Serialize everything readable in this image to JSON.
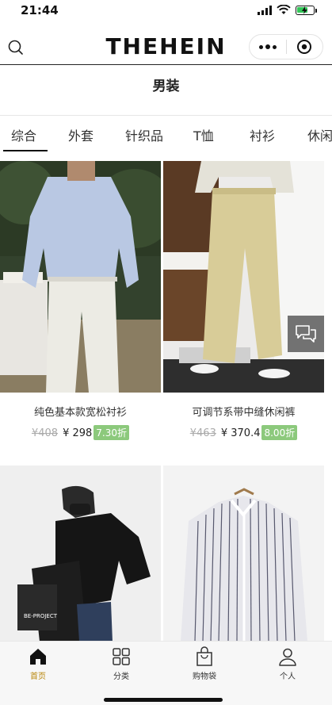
{
  "status": {
    "time": "21:44"
  },
  "header": {
    "brand": "THEHEIN"
  },
  "page": {
    "title": "男装"
  },
  "tabs": [
    "综合",
    "外套",
    "针织品",
    "T恤",
    "衬衫",
    "休闲"
  ],
  "products": [
    {
      "name": "纯色基本款宽松衬衫",
      "old_price": "¥408",
      "price": "¥ 298",
      "discount": "7.30折"
    },
    {
      "name": "可调节系带中缝休闲裤",
      "old_price": "¥463",
      "price": "¥ 370.4",
      "discount": "8.00折"
    },
    {
      "name": "",
      "old_price": "",
      "price": "",
      "discount": ""
    },
    {
      "name": "",
      "old_price": "",
      "price": "",
      "discount": ""
    }
  ],
  "bag_print": "BE-PROJECT",
  "nav": [
    {
      "label": "首页",
      "icon": "home-icon",
      "active": true
    },
    {
      "label": "分类",
      "icon": "grid-icon",
      "active": false
    },
    {
      "label": "购物袋",
      "icon": "bag-icon",
      "active": false
    },
    {
      "label": "个人",
      "icon": "person-icon",
      "active": false
    }
  ],
  "colors": {
    "discount_bg": "#8cc97c",
    "active_nav": "#b8860b",
    "text": "#222222"
  }
}
